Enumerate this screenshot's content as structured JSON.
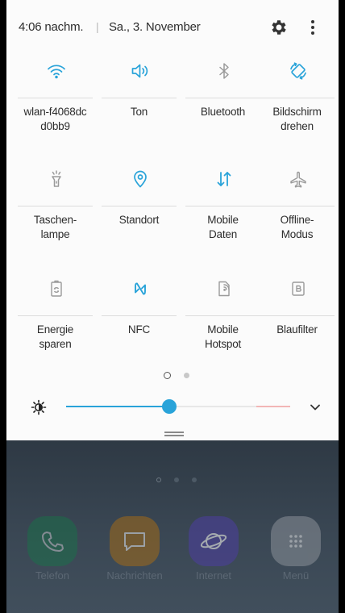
{
  "header": {
    "time": "4:06 nachm.",
    "separator": "|",
    "date": "Sa., 3. November",
    "settings_icon": "gear-icon",
    "more_icon": "more-vert-icon"
  },
  "tiles": [
    {
      "line1": "wlan-f4068dc",
      "line2": "d0bb9",
      "icon": "wifi-icon",
      "active": true
    },
    {
      "line1": "Ton",
      "line2": "",
      "icon": "volume-icon",
      "active": true
    },
    {
      "line1": "Bluetooth",
      "line2": "",
      "icon": "bluetooth-icon",
      "active": false
    },
    {
      "line1": "Bildschirm",
      "line2": "drehen",
      "icon": "auto-rotate-icon",
      "active": true
    },
    {
      "line1": "Taschen-",
      "line2": "lampe",
      "icon": "flashlight-icon",
      "active": false
    },
    {
      "line1": "Standort",
      "line2": "",
      "icon": "location-icon",
      "active": true
    },
    {
      "line1": "Mobile",
      "line2": "Daten",
      "icon": "mobile-data-icon",
      "active": true
    },
    {
      "line1": "Offline-",
      "line2": "Modus",
      "icon": "airplane-icon",
      "active": false
    },
    {
      "line1": "Energie",
      "line2": "sparen",
      "icon": "power-saving-icon",
      "active": false
    },
    {
      "line1": "NFC",
      "line2": "",
      "icon": "nfc-icon",
      "active": true
    },
    {
      "line1": "Mobile",
      "line2": "Hotspot",
      "icon": "hotspot-icon",
      "active": false
    },
    {
      "line1": "Blaufilter",
      "line2": "",
      "icon": "blue-light-filter-icon",
      "active": false
    }
  ],
  "pagination": {
    "current": 1,
    "total": 2
  },
  "brightness": {
    "level_percent": 46,
    "icon": "brightness-icon",
    "expand_icon": "chevron-down-icon"
  },
  "home": {
    "page_dots": 3,
    "active_page": 1,
    "dock": [
      {
        "label": "Telefon",
        "icon": "phone-icon",
        "color": "#137a47"
      },
      {
        "label": "Nachrichten",
        "icon": "message-icon",
        "color": "#a16a18"
      },
      {
        "label": "Internet",
        "icon": "internet-icon",
        "color": "#4b3f9a"
      },
      {
        "label": "Menü",
        "icon": "apps-grid-icon",
        "color": "#8a9098"
      }
    ]
  },
  "colors": {
    "accent": "#29a3d9",
    "tile_inactive": "#9a9a9a",
    "panel_background": "#fbfbfb"
  }
}
